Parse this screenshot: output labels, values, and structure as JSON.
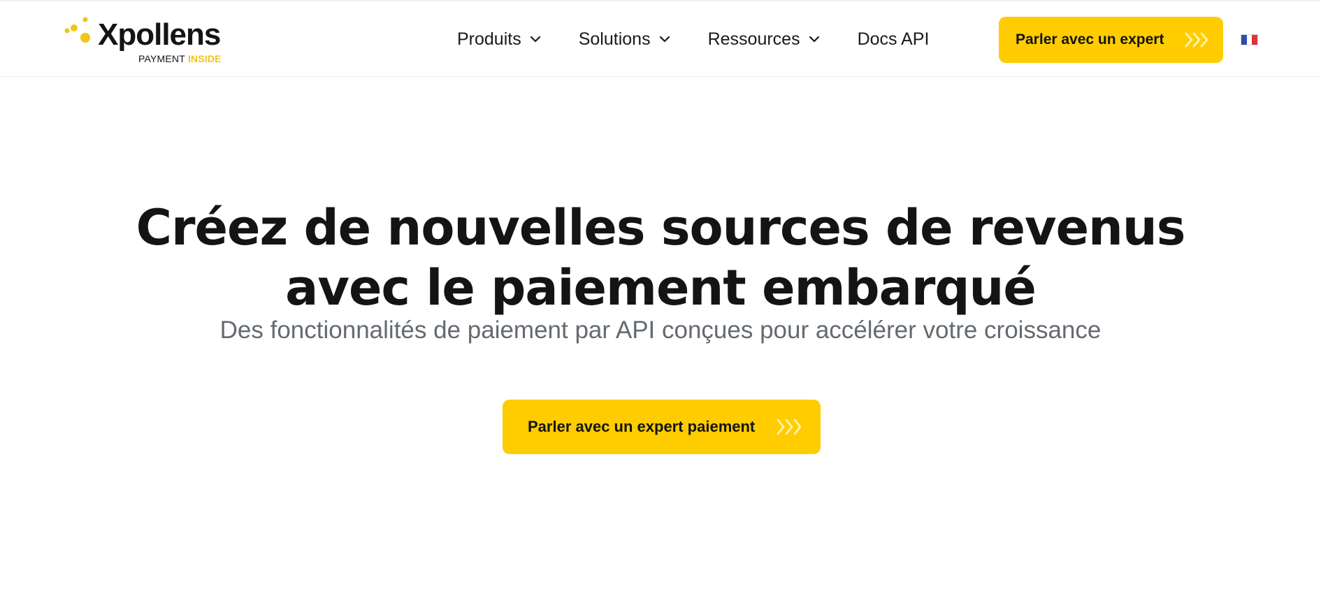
{
  "header": {
    "logo": {
      "name": "Xpollens",
      "tagline_prefix": "PAYMENT",
      "tagline_accent": "INSIDE"
    },
    "nav": [
      {
        "label": "Produits",
        "has_dropdown": true
      },
      {
        "label": "Solutions",
        "has_dropdown": true
      },
      {
        "label": "Ressources",
        "has_dropdown": true
      },
      {
        "label": "Docs API",
        "has_dropdown": false
      }
    ],
    "cta": {
      "label": "Parler avec un expert",
      "icon": "triple-chevron-right-icon"
    },
    "language": {
      "icon": "french-flag-icon"
    }
  },
  "hero": {
    "title_line1": "Créez de nouvelles sources de revenus",
    "title_line2": "avec le paiement embarqué",
    "subtitle": "Des fonctionnalités de paiement par API conçues pour accélérer votre croissance",
    "cta": {
      "label": "Parler avec un expert paiement",
      "icon": "triple-chevron-right-icon"
    }
  },
  "colors": {
    "accent": "#ffcc00",
    "logo_accent": "#f2c417",
    "text": "#141414",
    "subtitle": "#646a70"
  }
}
